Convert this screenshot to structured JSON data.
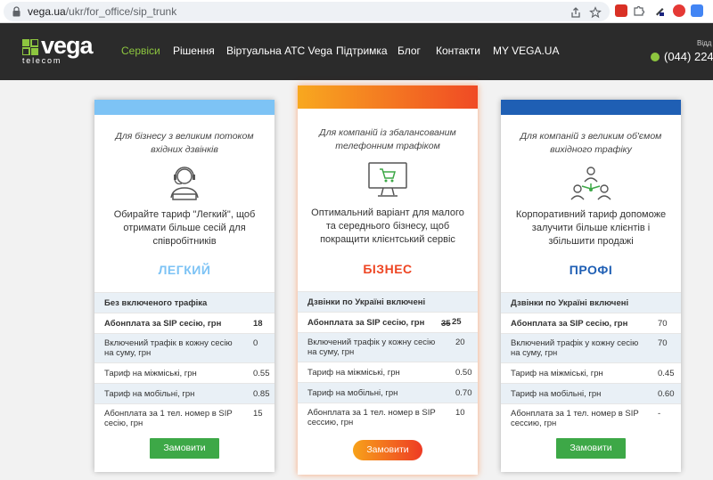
{
  "browser": {
    "url_host": "vega.ua",
    "url_path": "/ukr/for_office/sip_trunk",
    "icons": [
      "lock-icon",
      "share-icon",
      "star-icon"
    ],
    "extensions": [
      "extension-red-icon",
      "extension-puzzle-icon",
      "extension-pen-icon",
      "extension-youtube-icon",
      "extension-translate-icon"
    ]
  },
  "header": {
    "logo_word": "vega",
    "logo_sub": "telecom",
    "brand_color": "#8dc63f",
    "nav": [
      {
        "label": "Сервіси",
        "active": true
      },
      {
        "label": "Рішення",
        "active": false
      },
      {
        "label": "Віртуальна АТС Vega",
        "active": false
      },
      {
        "label": "Підтримка",
        "active": false
      },
      {
        "label": "Блог",
        "active": false
      },
      {
        "label": "Контакти",
        "active": false
      },
      {
        "label": "MY VEGA.UA",
        "active": false
      }
    ],
    "phone": "(044) 224",
    "phone_caption": "Відд"
  },
  "plans": [
    {
      "id": "light",
      "strip_color": "#7dc3f5",
      "tagline": "Для бізнесу з великим потоком вхідних дзвінків",
      "icon": "operator-headset-icon",
      "description": "Обирайте тариф \"Легкий\", щоб отримати більше сесій для співробітників",
      "name": "ЛЕГКИЙ",
      "name_color": "#7dc3f5",
      "header_row": "Без включеного трафіка",
      "rows": [
        {
          "label": "Абонплата за SIP сесію, грн",
          "value": "18",
          "bold": true
        },
        {
          "label": "Включений трафік в кожну сесію на суму, грн",
          "value": "0"
        },
        {
          "label": "Тариф на міжміські, грн",
          "value": "0.55"
        },
        {
          "label": "Тариф на мобільні, грн",
          "value": "0.85"
        },
        {
          "label": "Абонплата за 1 тел. номер в SIP сесію, грн",
          "value": "15"
        }
      ],
      "button": "Замовити"
    },
    {
      "id": "business",
      "strip_color": "#f36f21",
      "tagline": "Для компаній із збалансованим телефонним трафіком",
      "icon": "monitor-cart-icon",
      "description": "Оптимальний варіант для малого та середнього бізнесу, щоб покращити клієнтський сервіс",
      "name": "БІЗНЕС",
      "name_color": "#ee4523",
      "header_row": "Дзвінки по Україні включені",
      "rows": [
        {
          "label": "Абонплата за SIP сесію, грн",
          "old_value": "35",
          "value": "25",
          "bold": true
        },
        {
          "label": "Включений трафік у кожну сесію на суму, грн",
          "value": "20"
        },
        {
          "label": "Тариф на міжміські, грн",
          "value": "0.50"
        },
        {
          "label": "Тариф на мобільні, грн",
          "value": "0.70"
        },
        {
          "label": "Абонплата за 1 тел. номер в SIP сессию, грн",
          "value": "10"
        }
      ],
      "button": "Замовити"
    },
    {
      "id": "pro",
      "strip_color": "#1f5fb4",
      "tagline": "Для компаній з великим об'ємом вихідного трафіку",
      "icon": "team-network-icon",
      "description": "Корпоративний тариф допоможе залучити більше клієнтів і збільшити продажі",
      "name": "ПРОФІ",
      "name_color": "#1f5fb4",
      "header_row": "Дзвінки по Україні включені",
      "rows": [
        {
          "label": "Абонплата за SIP сесію, грн",
          "value": "70",
          "bold": true
        },
        {
          "label": "Включений трафік у кожну сесію на суму, грн",
          "value": "70"
        },
        {
          "label": "Тариф на міжміські, грн",
          "value": "0.45"
        },
        {
          "label": "Тариф на мобільні, грн",
          "value": "0.60"
        },
        {
          "label": "Абонплата за 1 тел. номер в SIP сессию, грн",
          "value": "-"
        }
      ],
      "button": "Замовити"
    }
  ]
}
